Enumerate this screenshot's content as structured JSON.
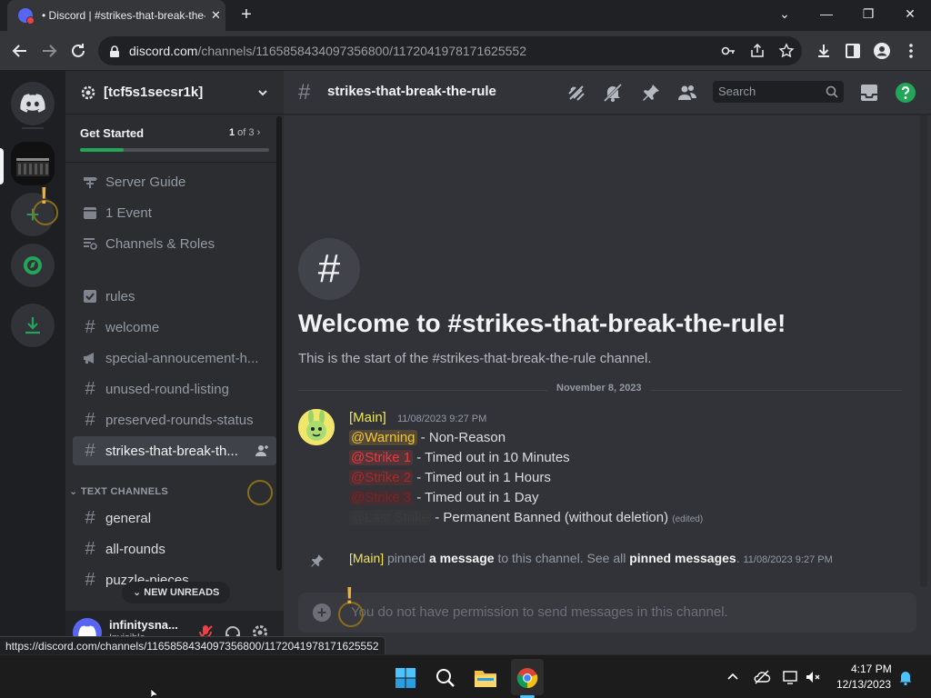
{
  "browser": {
    "tab_title": "• Discord | #strikes-that-break-the-rule",
    "tab_close": "✕",
    "new_tab": "+",
    "window_controls": {
      "minimize": "—",
      "restore": "❐",
      "close": "✕",
      "dropdown": "⌄"
    },
    "url_host": "discord.com",
    "url_path": "/channels/1165858434097356800/1172041978171625552",
    "status_url": "https://discord.com/channels/1165858434097356800/1172041978171625552"
  },
  "server": {
    "name": "[tcf5s1secsr1k]",
    "get_started_label": "Get Started",
    "get_started_count_current": "1",
    "get_started_count_rest": " of 3",
    "get_started_progress": 0.23
  },
  "sidebar": {
    "guide_items": [
      {
        "label": "Server Guide",
        "icon": "signpost-icon"
      },
      {
        "label": "1 Event",
        "icon": "calendar-icon"
      },
      {
        "label": "Channels & Roles",
        "icon": "browse-channels-icon"
      }
    ],
    "channels": [
      {
        "label": "rules",
        "icon": "rules-icon"
      },
      {
        "label": "welcome",
        "icon": "hash-icon"
      },
      {
        "label": "special-annoucement-h...",
        "icon": "announcement-icon"
      },
      {
        "label": "unused-round-listing",
        "icon": "hash-icon"
      },
      {
        "label": "preserved-rounds-status",
        "icon": "hash-icon"
      },
      {
        "label": "strikes-that-break-th...",
        "icon": "hash-icon",
        "active": true
      }
    ],
    "category": "TEXT CHANNELS",
    "category_channels": [
      {
        "label": "general"
      },
      {
        "label": "all-rounds"
      },
      {
        "label": "puzzle-pieces"
      }
    ],
    "new_unreads": "NEW UNREADS"
  },
  "user": {
    "name": "infinitysna...",
    "status": "Invisible"
  },
  "chat": {
    "channel_name": "strikes-that-break-the-rule",
    "search_placeholder": "Search",
    "welcome_title": "Welcome to #strikes-that-break-the-rule!",
    "welcome_sub": "This is the start of the #strikes-that-break-the-rule channel.",
    "date_divider": "November 8, 2023",
    "message": {
      "author": "[Main]",
      "timestamp": "11/08/2023 9:27 PM",
      "lines": [
        {
          "mention": "@Warning",
          "text": " - Non-Reason"
        },
        {
          "mention": "@Strike 1",
          "text": " - Timed out in 10 Minutes"
        },
        {
          "mention": "@Strike 2",
          "text": " - Timed out in 1 Hours"
        },
        {
          "mention": "@Strike 3",
          "text": " - Timed out in 1 Day"
        },
        {
          "mention": "@Last Strike",
          "text": " - Permanent Banned (without deletion)"
        }
      ],
      "edited": "(edited)"
    },
    "pin": {
      "author": "[Main]",
      "text_1": " pinned ",
      "link_1": "a message",
      "text_2": " to this channel. See all ",
      "link_2": "pinned messages",
      "text_3": ". ",
      "timestamp": "11/08/2023 9:27 PM"
    },
    "composer_placeholder": "You do not have permission to send messages in this channel."
  },
  "taskbar": {
    "time": "4:17 PM",
    "date": "12/13/2023"
  },
  "colors": {
    "discord_bg": "#313338",
    "sidebar_bg": "#2b2d31",
    "guild_bg": "#1e1f22",
    "accent_green": "#23a55a",
    "author_yellow": "#f0e55c",
    "blurple": "#5865f2"
  }
}
